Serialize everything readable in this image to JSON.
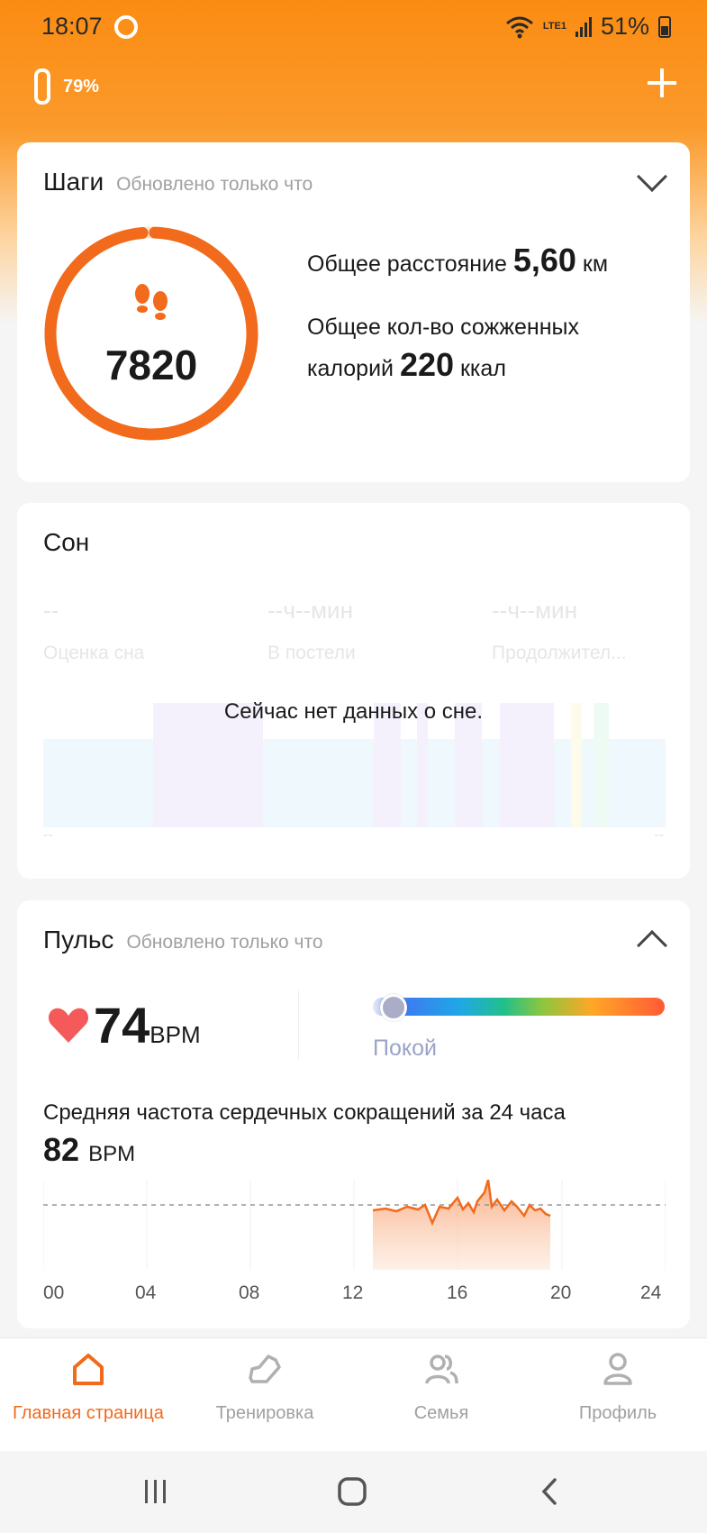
{
  "status_bar": {
    "time": "18:07",
    "battery": "51%",
    "network": "LTE1"
  },
  "device": {
    "battery": "79%"
  },
  "steps": {
    "title": "Шаги",
    "updated": "Обновлено только что",
    "count": "7820",
    "distance_label": "Общее расстояние",
    "distance_value": "5,60",
    "distance_unit": "км",
    "calories_label_1": "Общее кол-во сожженных",
    "calories_label_2": "калорий",
    "calories_value": "220",
    "calories_unit": "ккал",
    "goal_progress": 0.98
  },
  "sleep": {
    "title": "Сон",
    "score_value": "--",
    "score_label": "Оценка сна",
    "in_bed_value": "--ч--мин",
    "in_bed_label": "В постели",
    "duration_value": "--ч--мин",
    "duration_label": "Продолжител...",
    "no_data": "Сейчас нет данных о сне.",
    "axis_start": "--",
    "axis_end": "--"
  },
  "pulse": {
    "title": "Пульс",
    "updated": "Обновлено только что",
    "bpm": "74",
    "bpm_unit": "BPM",
    "zone": "Покой",
    "avg_title": "Средняя частота сердечных сокращений за 24 часа",
    "avg_value": "82",
    "avg_unit": "BPM",
    "x_ticks": [
      "00",
      "04",
      "08",
      "12",
      "16",
      "20",
      "24"
    ]
  },
  "nav": {
    "home": "Главная страница",
    "workout": "Тренировка",
    "family": "Семья",
    "profile": "Профиль"
  },
  "colors": {
    "accent": "#f26a1b",
    "header": "#fb8c12"
  }
}
